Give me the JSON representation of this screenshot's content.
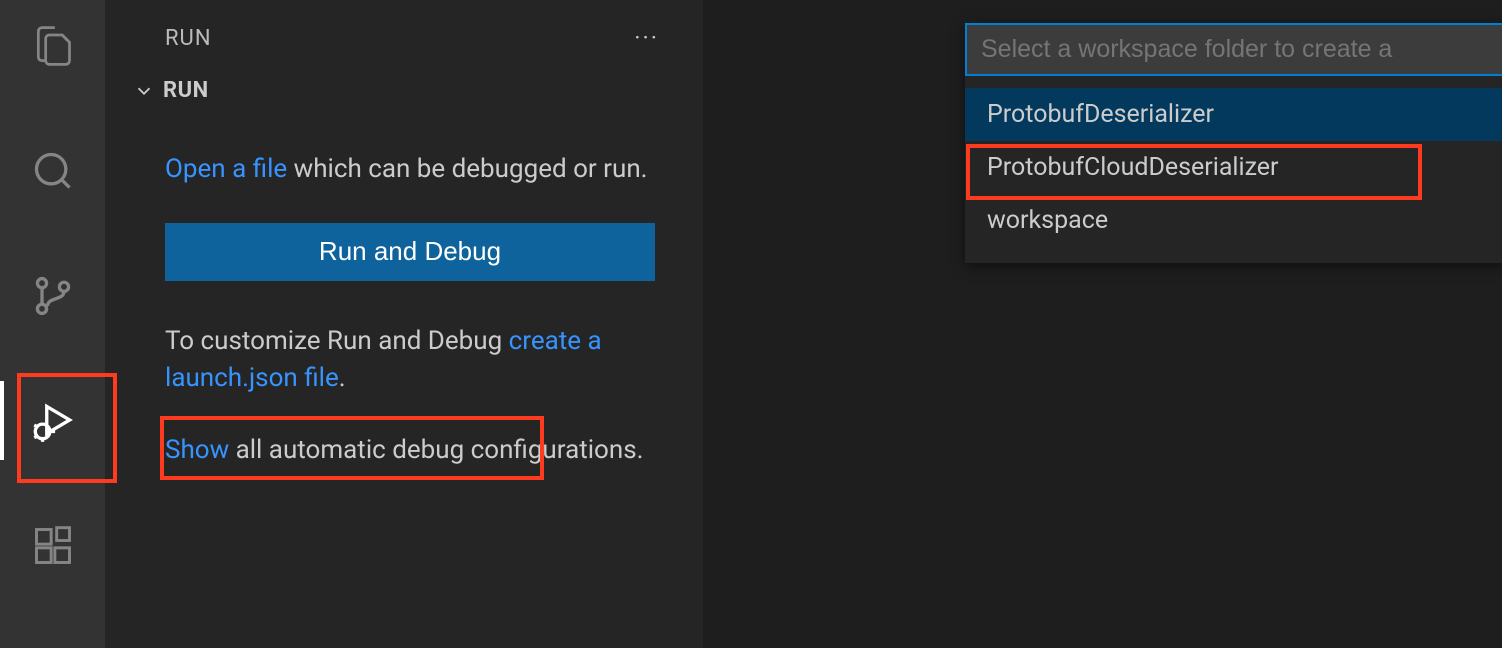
{
  "sidebar": {
    "title": "RUN",
    "section_title": "RUN",
    "open_file_link": "Open a file",
    "open_file_text": " which can be debugged or run.",
    "run_debug_button": "Run and Debug",
    "customize_text": "To customize Run and Debug ",
    "create_launch_link": "create a launch.json file",
    "period": ".",
    "show_link": "Show",
    "show_text": " all automatic debug configurations."
  },
  "quickpick": {
    "placeholder": "Select a workspace folder to create a",
    "items": [
      "ProtobufDeserializer",
      "ProtobufCloudDeserializer",
      "workspace"
    ]
  }
}
